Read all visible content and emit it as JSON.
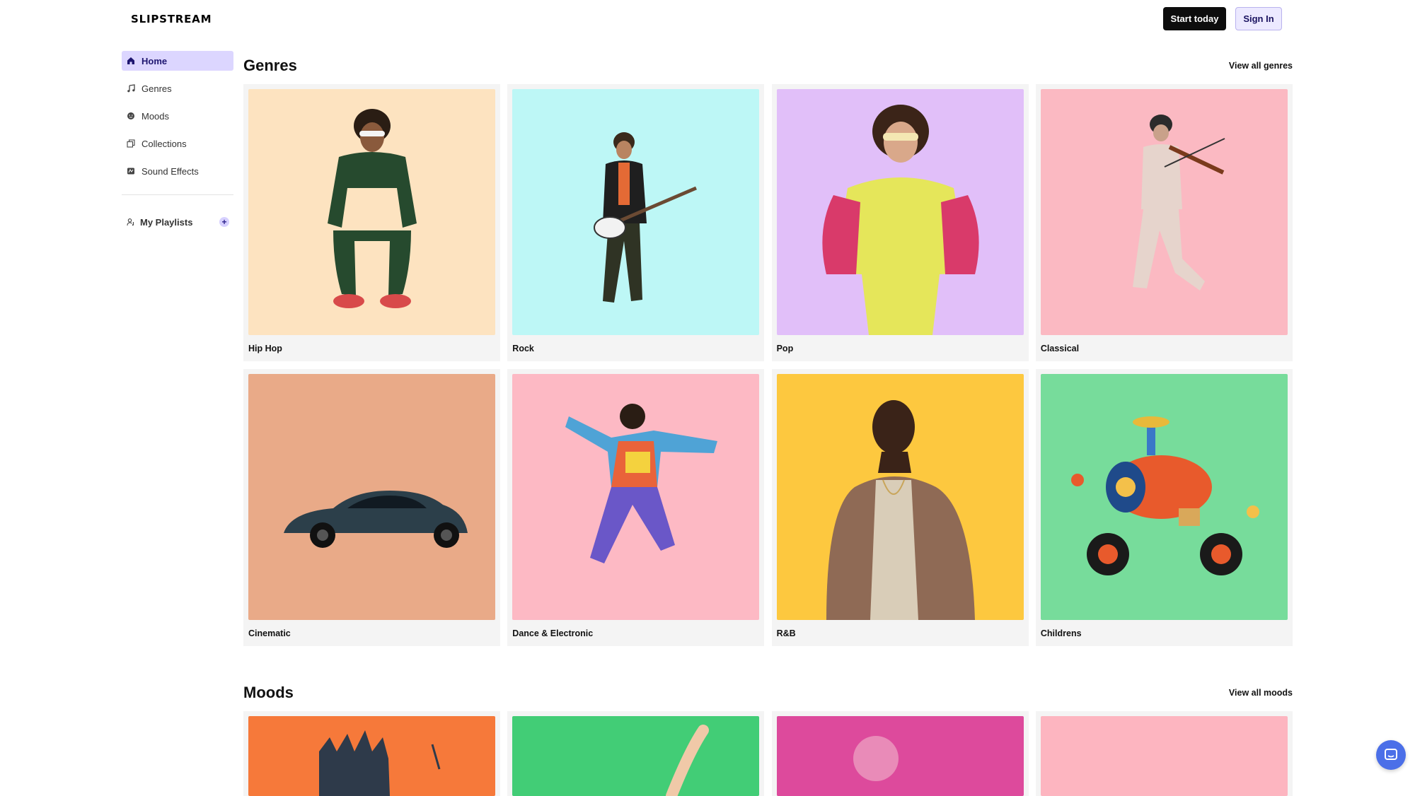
{
  "header": {
    "logo": "SLIPSTREAM",
    "start_label": "Start today",
    "signin_label": "Sign In"
  },
  "sidebar": {
    "items": [
      {
        "label": "Home",
        "icon": "home-icon",
        "active": true
      },
      {
        "label": "Genres",
        "icon": "music-note-icon",
        "active": false
      },
      {
        "label": "Moods",
        "icon": "smiley-icon",
        "active": false
      },
      {
        "label": "Collections",
        "icon": "collections-icon",
        "active": false
      },
      {
        "label": "Sound Effects",
        "icon": "sfx-icon",
        "active": false
      }
    ],
    "playlists_label": "My Playlists",
    "playlists_icon": "user-music-icon",
    "add_icon": "plus-icon"
  },
  "genres": {
    "title": "Genres",
    "view_all": "View all genres",
    "cards": [
      {
        "label": "Hip Hop",
        "bg": "#fde3c0"
      },
      {
        "label": "Rock",
        "bg": "#bdf7f6"
      },
      {
        "label": "Pop",
        "bg": "#e1bff9"
      },
      {
        "label": "Classical",
        "bg": "#fbb9c2"
      },
      {
        "label": "Cinematic",
        "bg": "#e9aa88"
      },
      {
        "label": "Dance & Electronic",
        "bg": "#fdb9c4"
      },
      {
        "label": "R&B",
        "bg": "#fdc83f"
      },
      {
        "label": "Childrens",
        "bg": "#77dc9b"
      }
    ]
  },
  "moods": {
    "title": "Moods",
    "view_all": "View all moods",
    "cards": [
      {
        "bg": "#f6793a"
      },
      {
        "bg": "#42cd76"
      },
      {
        "bg": "#dd4a9c"
      },
      {
        "bg": "#fdb5c0"
      }
    ]
  },
  "colors": {
    "accent": "#dcd6ff",
    "accent_text": "#1e1670",
    "chat": "#4b6fe8"
  }
}
